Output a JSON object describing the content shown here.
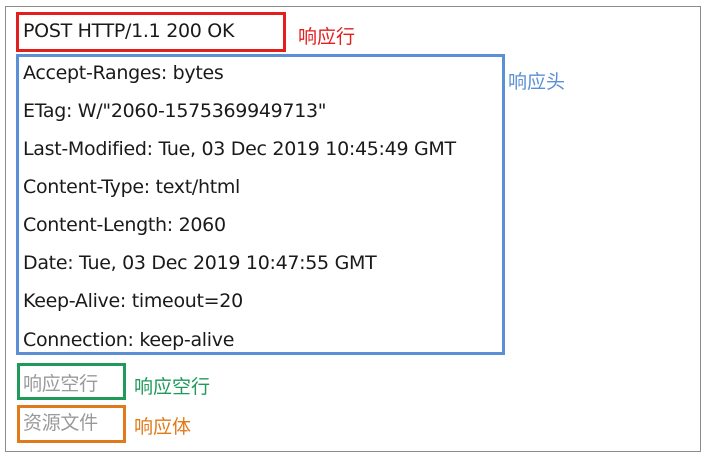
{
  "status_line": {
    "text": "POST HTTP/1.1 200 OK",
    "label": "响应行",
    "color": "#e31e1e"
  },
  "headers": {
    "label": "响应头",
    "color": "#5b8fd6",
    "lines": [
      "Accept-Ranges: bytes",
      "ETag: W/\"2060-1575369949713\"",
      "Last-Modified: Tue, 03 Dec 2019 10:45:49 GMT",
      "Content-Type: text/html",
      "Content-Length: 2060",
      "Date: Tue, 03 Dec 2019 10:47:55 GMT",
      "Keep-Alive: timeout=20",
      "Connection: keep-alive"
    ]
  },
  "blank_line": {
    "text": "响应空行",
    "label": "响应空行",
    "color": "#1f9a5a"
  },
  "body": {
    "text": "资源文件",
    "label": "响应体",
    "color": "#e07a1a"
  }
}
